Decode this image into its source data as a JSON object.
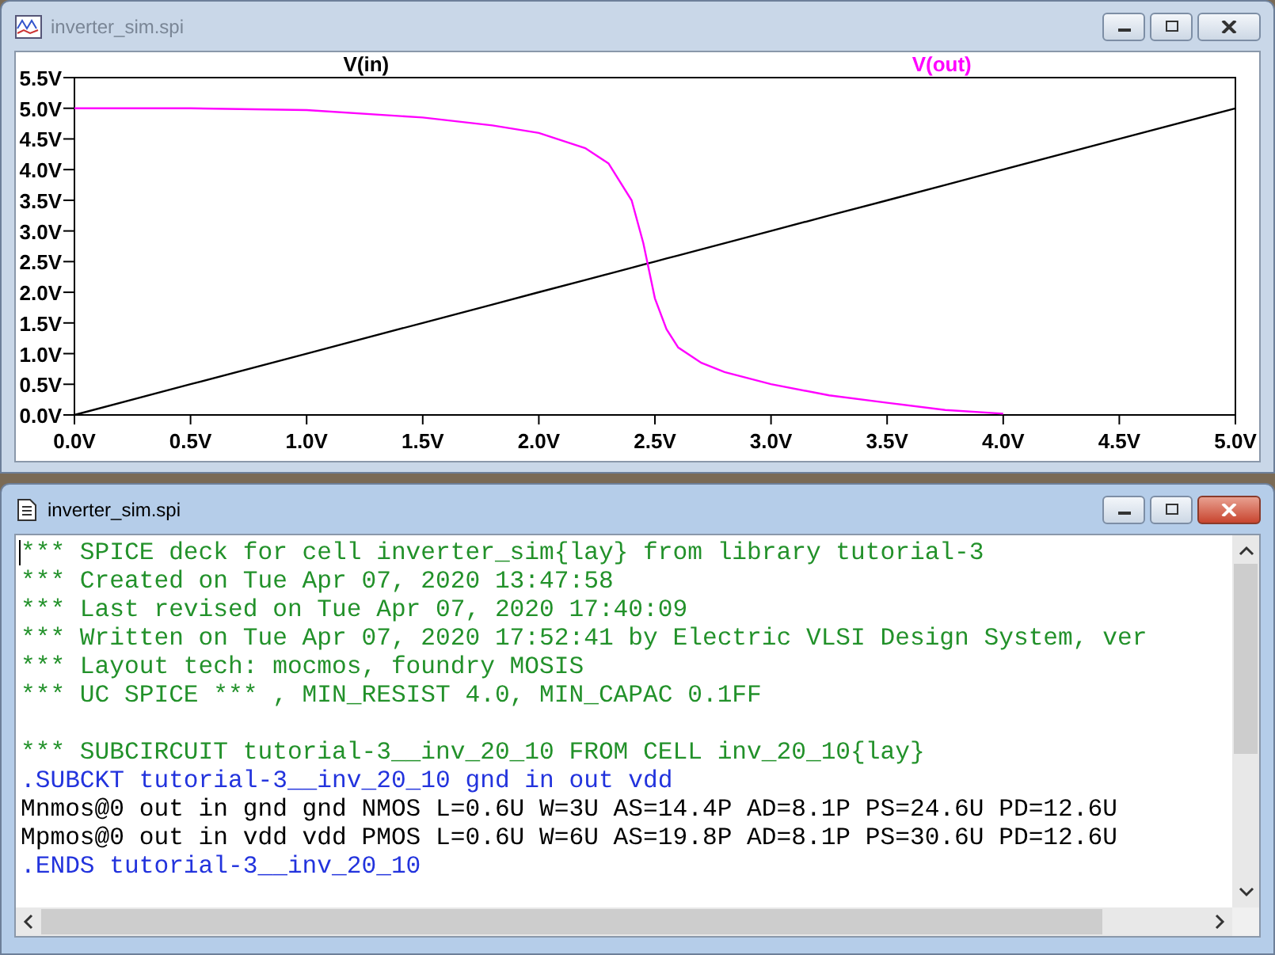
{
  "plot_window": {
    "title": "inverter_sim.spi",
    "active": false,
    "chart_data": {
      "type": "line",
      "x": [
        0,
        0.5,
        1.0,
        1.5,
        1.8,
        2.0,
        2.2,
        2.3,
        2.4,
        2.45,
        2.5,
        2.55,
        2.6,
        2.7,
        2.8,
        3.0,
        3.25,
        3.5,
        3.75,
        4.0,
        4.5,
        5.0
      ],
      "series": [
        {
          "name": "V(in)",
          "color": "#000000",
          "values": [
            0,
            0.5,
            1.0,
            1.5,
            1.8,
            2.0,
            2.2,
            2.3,
            2.4,
            2.45,
            2.5,
            2.55,
            2.6,
            2.7,
            2.8,
            3.0,
            3.25,
            3.5,
            3.75,
            4.0,
            4.5,
            5.0
          ]
        },
        {
          "name": "V(out)",
          "color": "#ff00ff",
          "values": [
            5.0,
            5.0,
            4.97,
            4.85,
            4.72,
            4.6,
            4.35,
            4.1,
            3.5,
            2.8,
            1.9,
            1.4,
            1.1,
            0.85,
            0.7,
            0.5,
            0.32,
            0.2,
            0.08,
            0.02,
            null,
            null
          ]
        }
      ],
      "xlim": [
        0,
        5
      ],
      "ylim": [
        0,
        5.5
      ],
      "xticks": [
        {
          "value": 0,
          "label": "0.0V"
        },
        {
          "value": 0.5,
          "label": "0.5V"
        },
        {
          "value": 1,
          "label": "1.0V"
        },
        {
          "value": 1.5,
          "label": "1.5V"
        },
        {
          "value": 2,
          "label": "2.0V"
        },
        {
          "value": 2.5,
          "label": "2.5V"
        },
        {
          "value": 3,
          "label": "3.0V"
        },
        {
          "value": 3.5,
          "label": "3.5V"
        },
        {
          "value": 4,
          "label": "4.0V"
        },
        {
          "value": 4.5,
          "label": "4.5V"
        },
        {
          "value": 5,
          "label": "5.0V"
        }
      ],
      "yticks": [
        {
          "value": 0,
          "label": "0.0V"
        },
        {
          "value": 0.5,
          "label": "0.5V"
        },
        {
          "value": 1,
          "label": "1.0V"
        },
        {
          "value": 1.5,
          "label": "1.5V"
        },
        {
          "value": 2,
          "label": "2.0V"
        },
        {
          "value": 2.5,
          "label": "2.5V"
        },
        {
          "value": 3,
          "label": "3.0V"
        },
        {
          "value": 3.5,
          "label": "3.5V"
        },
        {
          "value": 4,
          "label": "4.0V"
        },
        {
          "value": 4.5,
          "label": "4.5V"
        },
        {
          "value": 5,
          "label": "5.0V"
        },
        {
          "value": 5.5,
          "label": "5.5V"
        }
      ]
    }
  },
  "text_window": {
    "title": "inverter_sim.spi",
    "active": true,
    "lines": [
      {
        "kind": "comment",
        "text": "*** SPICE deck for cell inverter_sim{lay} from library tutorial-3"
      },
      {
        "kind": "comment",
        "text": "*** Created on Tue Apr 07, 2020 13:47:58"
      },
      {
        "kind": "comment",
        "text": "*** Last revised on Tue Apr 07, 2020 17:40:09"
      },
      {
        "kind": "comment",
        "text": "*** Written on Tue Apr 07, 2020 17:52:41 by Electric VLSI Design System, ver"
      },
      {
        "kind": "comment",
        "text": "*** Layout tech: mocmos, foundry MOSIS"
      },
      {
        "kind": "comment",
        "text": "*** UC SPICE *** , MIN_RESIST 4.0, MIN_CAPAC 0.1FF"
      },
      {
        "kind": "blank"
      },
      {
        "kind": "comment",
        "text": "*** SUBCIRCUIT tutorial-3__inv_20_10 FROM CELL inv_20_10{lay}"
      },
      {
        "kind": "directive",
        "text": ".SUBCKT tutorial-3__inv_20_10 gnd in out vdd"
      },
      {
        "kind": "plain",
        "text": "Mnmos@0 out in gnd gnd NMOS L=0.6U W=3U AS=14.4P AD=8.1P PS=24.6U PD=12.6U"
      },
      {
        "kind": "plain",
        "text": "Mpmos@0 out in vdd vdd PMOS L=0.6U W=6U AS=19.8P AD=8.1P PS=30.6U PD=12.6U"
      },
      {
        "kind": "directive",
        "text": ".ENDS tutorial-3__inv_20_10"
      }
    ]
  }
}
